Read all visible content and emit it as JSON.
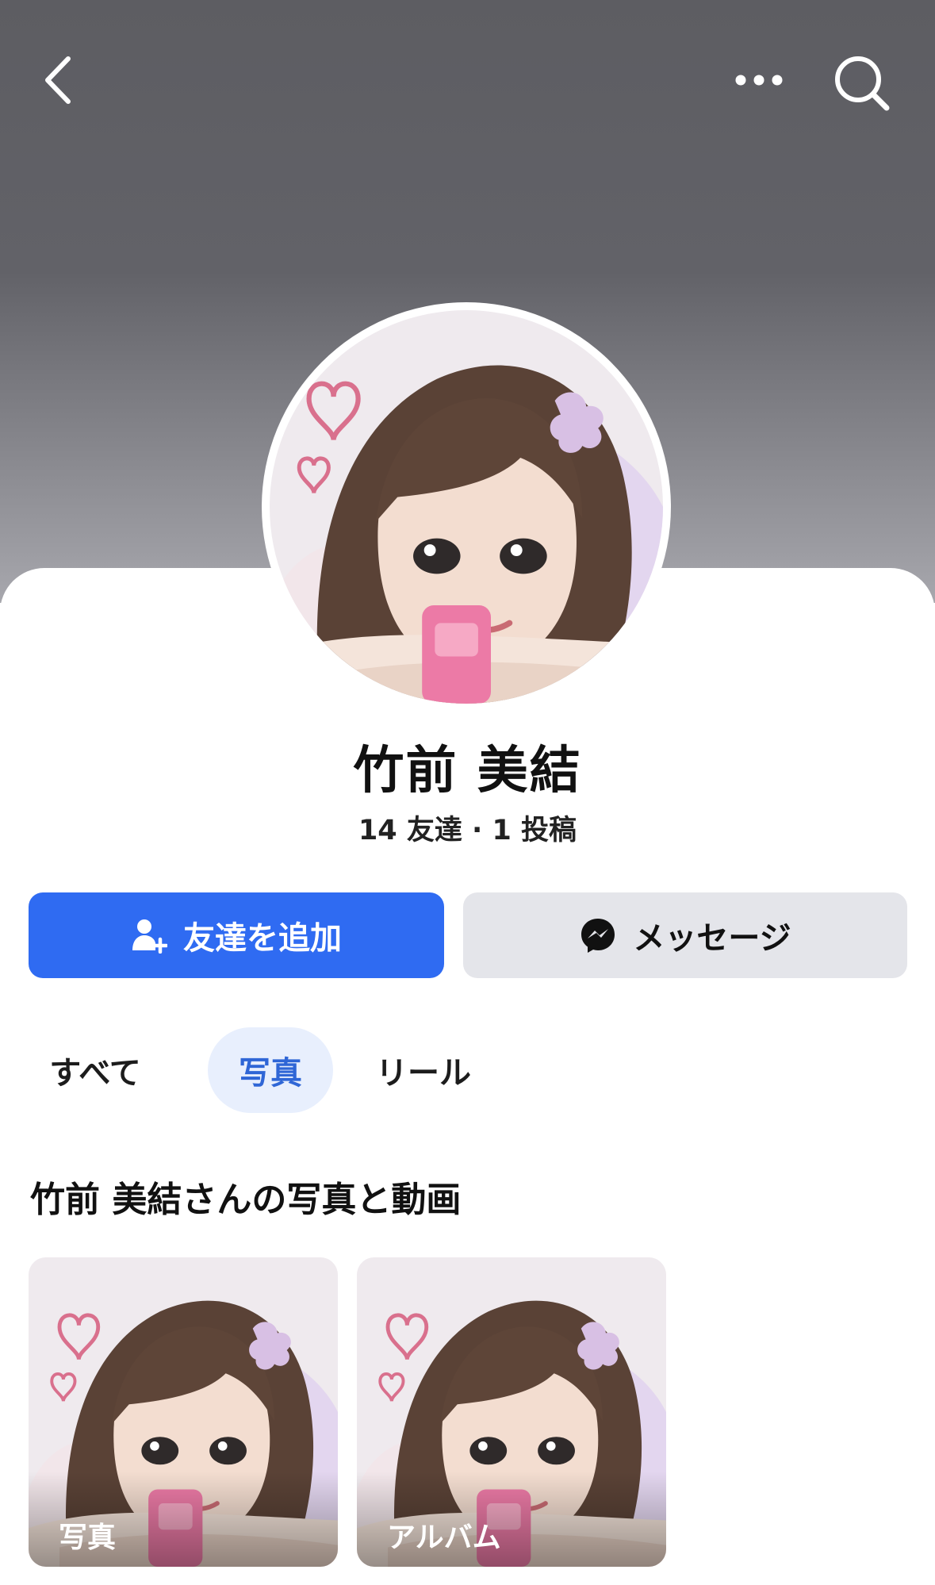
{
  "profile": {
    "name": "竹前 美結",
    "stats": "14 友達 · 1 投稿"
  },
  "actions": {
    "add_friend_label": "友達を追加",
    "message_label": "メッセージ"
  },
  "tabs": [
    {
      "label": "すべて",
      "selected": false
    },
    {
      "label": "写真",
      "selected": true
    },
    {
      "label": "リール",
      "selected": false
    }
  ],
  "section": {
    "title": "竹前 美結さんの写真と動画"
  },
  "tiles": [
    {
      "label": "写真"
    },
    {
      "label": "アルバム"
    }
  ],
  "icons": {
    "back": "chevron-left-icon",
    "more": "more-dots-icon",
    "search": "search-icon",
    "add_friend": "person-plus-icon",
    "messenger": "messenger-icon"
  },
  "colors": {
    "primary": "#2f6bf2",
    "secondary_button": "#e4e5ea",
    "selected_tab_bg": "#e8effd",
    "selected_tab_text": "#2f66d6",
    "cover_top": "#5d5d62"
  }
}
